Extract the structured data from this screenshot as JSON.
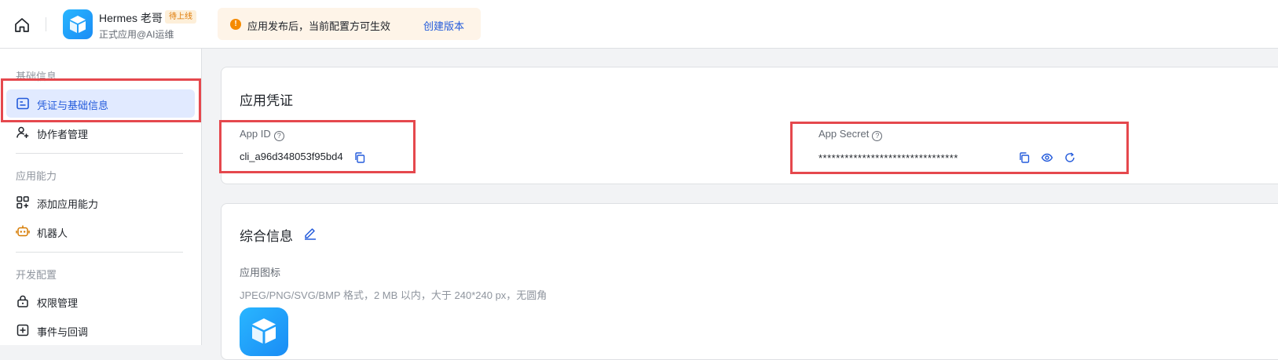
{
  "topbar": {
    "app_name": "Hermes 老哥",
    "status_badge": "待上线",
    "app_type": "正式应用@AI运维",
    "notice_text": "应用发布后，当前配置方可生效",
    "notice_link": "创建版本"
  },
  "sidebar": {
    "group_basic": "基础信息",
    "item_credentials": "凭证与基础信息",
    "item_collaborators": "协作者管理",
    "group_capabilities": "应用能力",
    "item_add_capability": "添加应用能力",
    "item_bot": "机器人",
    "group_dev": "开发配置",
    "item_permissions": "权限管理",
    "item_events": "事件与回调"
  },
  "credentials": {
    "title": "应用凭证",
    "app_id_label": "App ID",
    "app_id_value": "cli_a96d348053f95bd4",
    "app_secret_label": "App Secret",
    "app_secret_value": "********************************"
  },
  "general": {
    "title": "综合信息",
    "icon_label": "应用图标",
    "icon_hint": "JPEG/PNG/SVG/BMP 格式，2 MB 以内，大于 240*240 px，无圆角"
  },
  "colors": {
    "accent": "#245bdb",
    "highlight_box": "#e5484d",
    "badge_text": "#de7802",
    "notice_bg": "#fef4e8"
  }
}
